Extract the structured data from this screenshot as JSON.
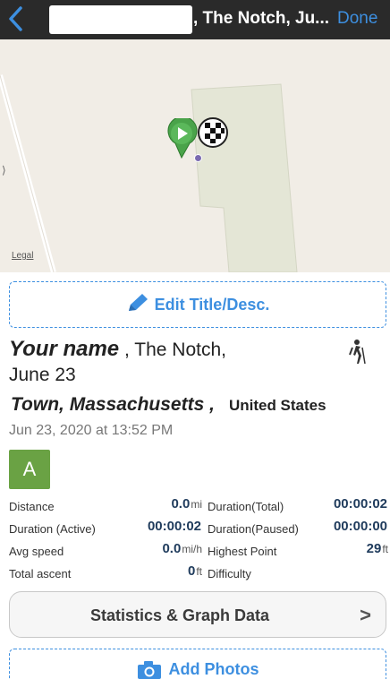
{
  "navbar": {
    "back_icon": "chevron-left-icon",
    "title": ", The Notch, Ju...",
    "done_label": "Done",
    "accent_color": "#3d8fe0"
  },
  "map": {
    "legal_label": "Legal",
    "start_marker_icon": "play-marker-icon",
    "finish_marker_icon": "checkered-flag-icon"
  },
  "edit_button": {
    "label": "Edit Title/Desc.",
    "icon": "pencil-icon"
  },
  "track": {
    "name": "Your name",
    "title_rest": " , The Notch,",
    "title_line2": "June 23",
    "town": "Town, Massachusetts ,",
    "country": "United States",
    "date": "Jun 23, 2020 at 13:52 PM",
    "activity_icon": "hiker-icon",
    "grade": "A",
    "grade_color": "#6aa244"
  },
  "stats": {
    "rows": [
      {
        "label1": "Distance",
        "value1": "0.0",
        "unit1": "mi",
        "label2": "Duration(Total)",
        "value2": "00:00:02",
        "unit2": ""
      },
      {
        "label1": "Duration (Active)",
        "value1": "00:00:02",
        "unit1": "",
        "label2": "Duration(Paused)",
        "value2": "00:00:00",
        "unit2": ""
      },
      {
        "label1": "Avg speed",
        "value1": "0.0",
        "unit1": "mi/h",
        "label2": "Highest Point",
        "value2": "29",
        "unit2": "ft"
      },
      {
        "label1": "Total ascent",
        "value1": "0",
        "unit1": "ft",
        "label2": "Difficulty",
        "value2": "",
        "unit2": ""
      }
    ]
  },
  "stat_button": {
    "label": "Statistics & Graph Data",
    "chevron": ">"
  },
  "photo_button": {
    "label": "Add Photos",
    "icon": "camera-icon"
  }
}
